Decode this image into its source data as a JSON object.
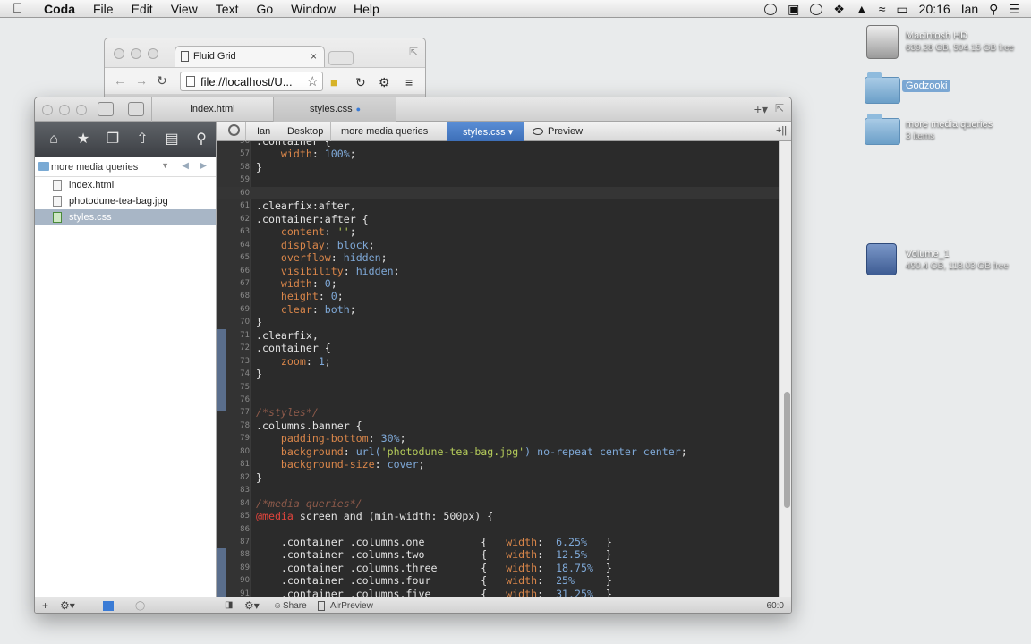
{
  "menubar": {
    "apple": "",
    "app": "Coda",
    "items": [
      "File",
      "Edit",
      "View",
      "Text",
      "Go",
      "Window",
      "Help"
    ],
    "time": "20:16",
    "user": "Ian"
  },
  "desktop": {
    "hd": {
      "name": "Macintosh HD",
      "sub": "639.28 GB, 504.15 GB free"
    },
    "godzooki": {
      "name": "Godzooki"
    },
    "folder": {
      "name": "more media queries",
      "sub": "3 items"
    },
    "volume": {
      "name": "Volume_1",
      "sub": "490.4 GB, 118.03 GB free"
    }
  },
  "browser": {
    "tab_title": "Fluid Grid",
    "tab_close": "×",
    "url": "file://localhost/U..."
  },
  "coda": {
    "tabs": [
      "index.html",
      "styles.css"
    ],
    "sidebar": {
      "site": "more media queries",
      "files": [
        "index.html",
        "photodune-tea-bag.jpg",
        "styles.css"
      ]
    },
    "breadcrumbs": [
      "Ian",
      "Desktop",
      "more media queries",
      "styles.css",
      "Preview"
    ],
    "status": {
      "share": "Share",
      "airpreview": "AirPreview",
      "position": "60:0"
    }
  }
}
